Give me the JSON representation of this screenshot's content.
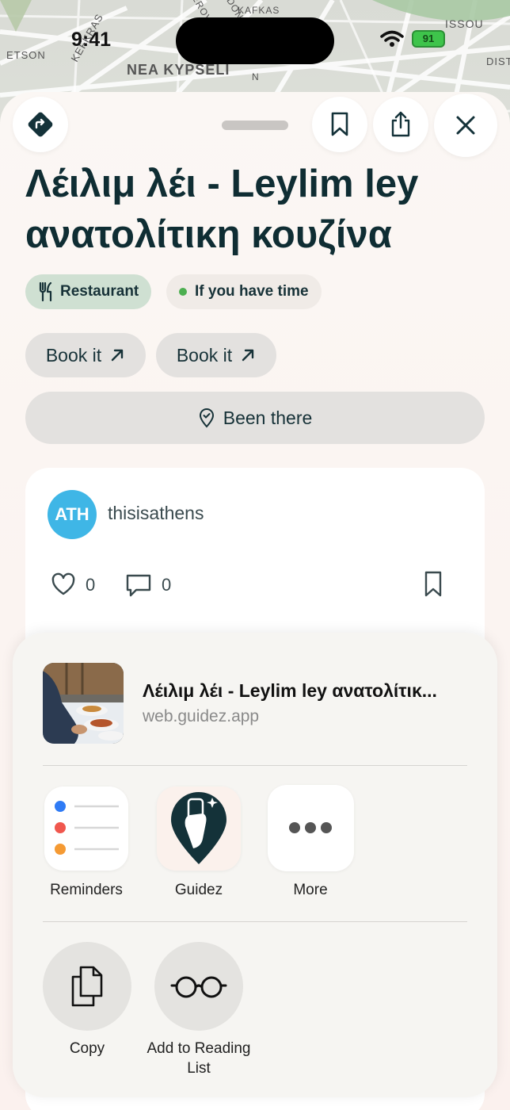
{
  "status_bar": {
    "time": "9:41",
    "battery": "91"
  },
  "map": {
    "district_label": "NEA KYPSELI",
    "street_labels": [
      "ETSON",
      "KEFKRAS",
      "KAFKAS",
      "EROV",
      "DON",
      "N",
      "ISSOU",
      "DIST"
    ]
  },
  "header": {
    "directions_icon": "directions-arrow-icon",
    "bookmark_icon": "bookmark-icon",
    "share_icon": "share-icon",
    "close_icon": "close-icon"
  },
  "place": {
    "title": "Λέιλιμ λέι - Leylim ley ανατολίτικη κουζίνα",
    "category_chip": "Restaurant",
    "priority_chip": "If you have time",
    "book_buttons": [
      "Book it",
      "Book it"
    ],
    "been_there_label": "Been there"
  },
  "post": {
    "author": "thisisathens",
    "avatar_text": "ΑΤΗ",
    "likes": "0",
    "comments": "0"
  },
  "share_sheet": {
    "title": "Λέιλιμ λέι - Leylim ley ανατολίτικ...",
    "url": "web.guidez.app",
    "apps": [
      {
        "label": "Reminders",
        "icon": "reminders-icon"
      },
      {
        "label": "Guidez",
        "icon": "guidez-icon"
      },
      {
        "label": "More",
        "icon": "more-icon"
      }
    ],
    "actions": [
      {
        "label": "Copy",
        "icon": "copy-icon"
      },
      {
        "label": "Add to Reading List",
        "icon": "reading-glasses-icon"
      }
    ]
  },
  "colors": {
    "accent_dark": "#143239",
    "restaurant_chip": "#cfe0d2",
    "priority_dot": "#4caf50",
    "avatar": "#3fb6e6"
  }
}
